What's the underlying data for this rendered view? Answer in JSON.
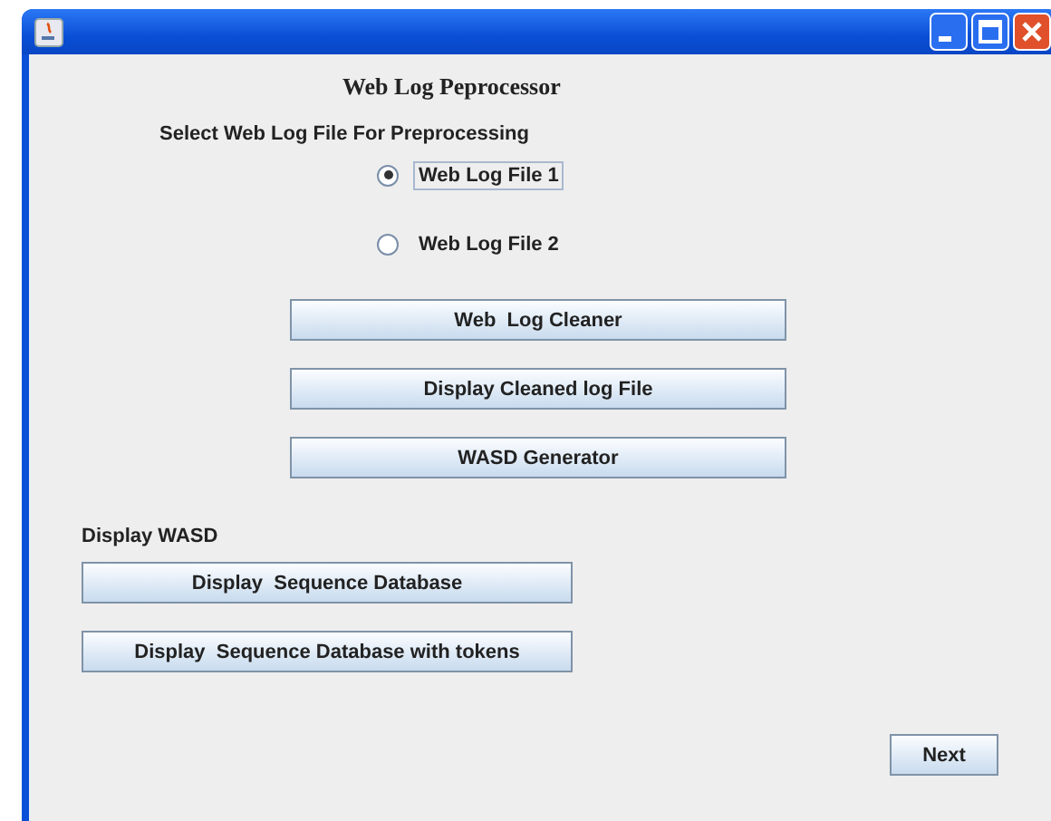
{
  "heading": "Web Log Peprocessor",
  "file_prompt": "Select Web Log File For Preprocessing",
  "radios": [
    {
      "label": "Web Log File 1",
      "selected": true
    },
    {
      "label": "Web Log File 2",
      "selected": false
    }
  ],
  "main_buttons": [
    "Web  Log Cleaner",
    "Display Cleaned log File",
    "WASD Generator"
  ],
  "wasd_label": "Display WASD",
  "wasd_buttons": [
    "Display  Sequence Database",
    "Display  Sequence Database with tokens"
  ],
  "next_button": "Next"
}
